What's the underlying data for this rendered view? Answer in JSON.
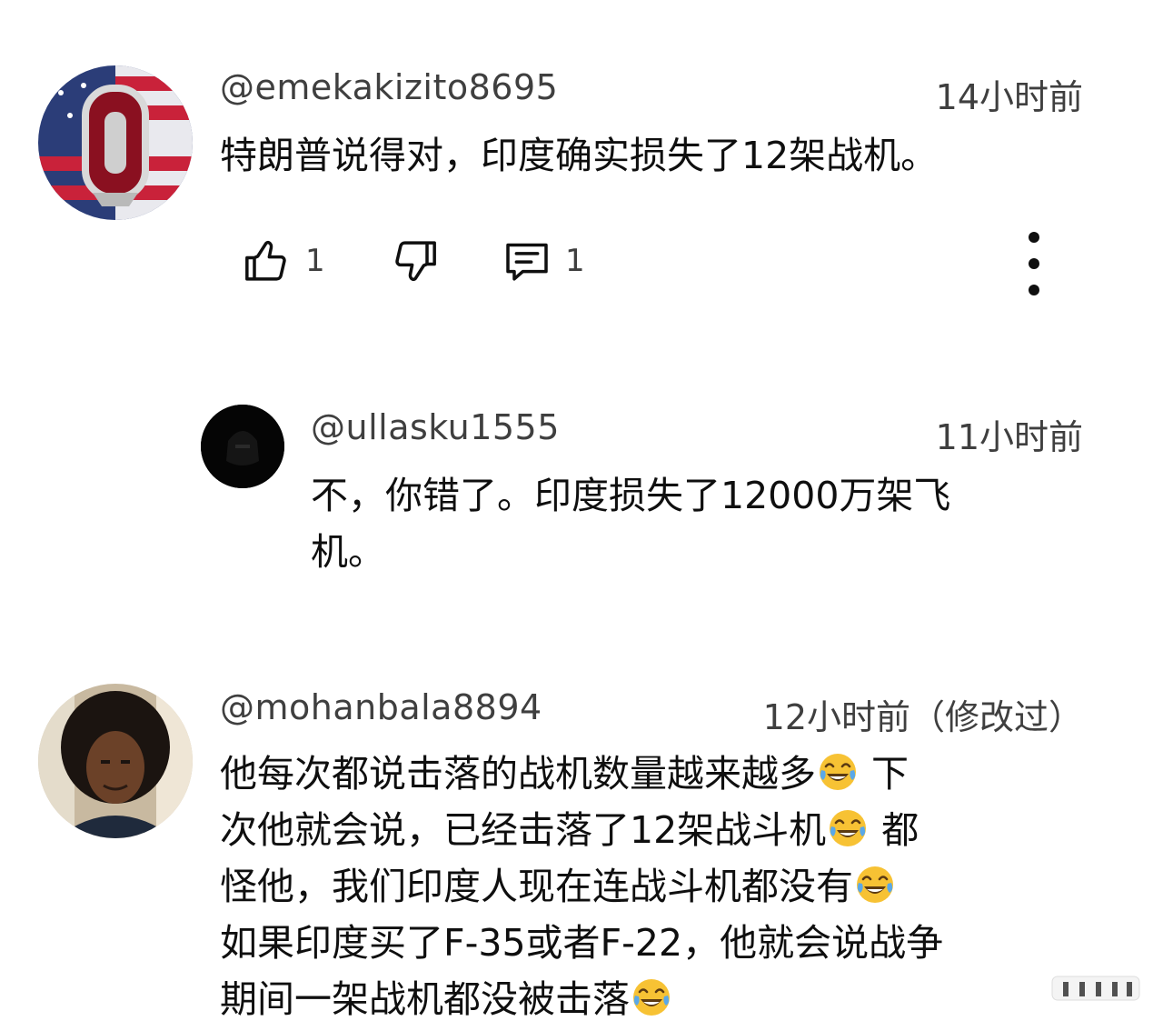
{
  "comments": [
    {
      "handle": "@emekakizito8695",
      "time": "14小时前",
      "text": "特朗普说得对，印度确实损失了12架战机。",
      "likes": "1",
      "replies": "1"
    },
    {
      "handle": "@ullasku1555",
      "time": "11小时前",
      "text": "不，你错了。印度损失了12000万架飞\n机。"
    },
    {
      "handle": "@mohanbala8894",
      "time": "12小时前（修改过）",
      "text_segments": [
        "他每次都说击落的战机数量越来越多",
        " 下\n次他就会说，已经击落了12架战斗机",
        " 都\n怪他，我们印度人现在连战斗机都没有",
        "\n如果印度买了F-35或者F-22，他就会说战争\n期间一架战机都没被击落",
        ""
      ]
    }
  ],
  "icons": {
    "like": "thumbs-up-icon",
    "dislike": "thumbs-down-icon",
    "reply": "comment-icon",
    "more": "more-vertical-icon",
    "emoji": "face-with-tears-of-joy-emoji"
  },
  "colors": {
    "text": "#0f0f0f",
    "secondary_text": "#3f3f3f",
    "emoji_face": "#f7c234",
    "emoji_tears": "#5aa8e8"
  }
}
